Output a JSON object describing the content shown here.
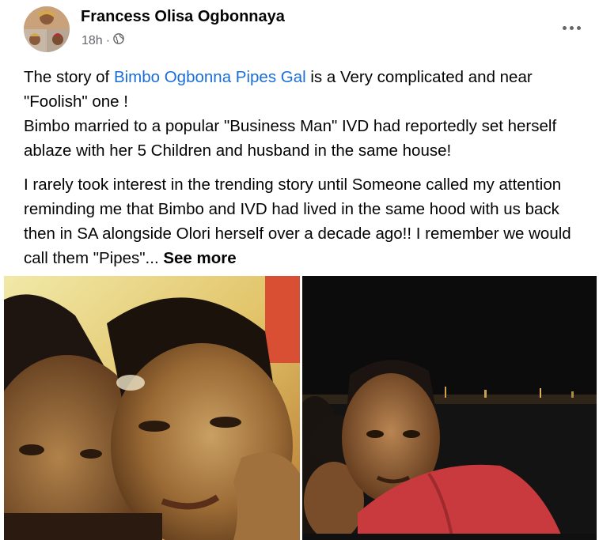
{
  "post": {
    "author": "Francess Olisa Ogbonnaya",
    "time": "18h",
    "dot": "·",
    "more_icon": "more-horizontal-icon",
    "privacy_icon": "globe-icon",
    "p1_a": "The story of ",
    "p1_link": "Bimbo Ogbonna Pipes Gal",
    "p1_b": "  is a Very complicated and near \"Foolish\" one !",
    "p1_c": "Bimbo married to a popular \"Business Man\" IVD  had reportedly set herself ablaze with her 5 Children and husband in the same house!",
    "p2": "I rarely took interest in the trending story until Someone called my attention reminding me that Bimbo and IVD had lived in the same hood with us back then in SA alongside Olori herself over a decade ago!! I remember we would call them \"Pipes\"...",
    "see_more": "See more"
  },
  "colors": {
    "link": "#1a6ed8",
    "meta": "#65676b",
    "text": "#050505"
  }
}
